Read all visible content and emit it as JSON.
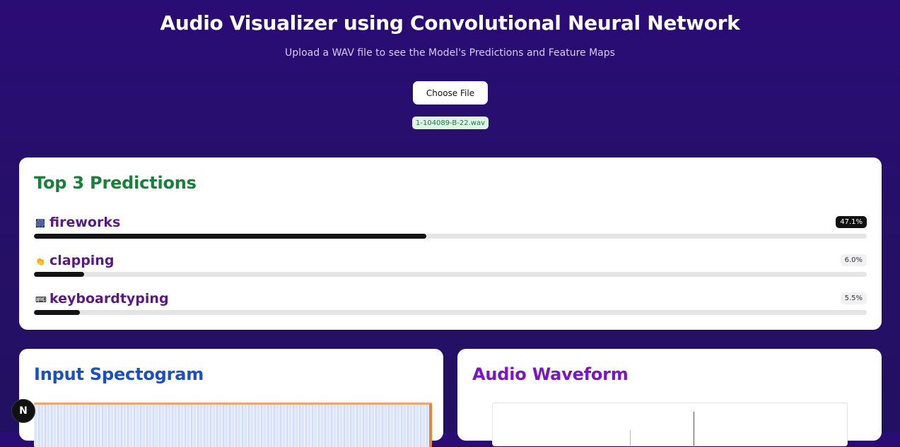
{
  "header": {
    "title": "Audio Visualizer using Convolutional Neural Network",
    "subtitle": "Upload a WAV file to see the Model's Predictions and Feature Maps",
    "choose_file_label": "Choose File",
    "file_name": "1-104089-B-22.wav"
  },
  "predictions": {
    "title": "Top 3 Predictions",
    "items": [
      {
        "icon": "fireworks-icon",
        "glyph": "🎆",
        "label": "fireworks",
        "percent": "47.1%",
        "fraction": 0.471
      },
      {
        "icon": "clapping-icon",
        "glyph": "👏",
        "label": "clapping",
        "percent": "6.0%",
        "fraction": 0.06
      },
      {
        "icon": "keyboard-icon",
        "glyph": "⌨",
        "label": "keyboardtyping",
        "percent": "5.5%",
        "fraction": 0.055
      }
    ]
  },
  "spectrogram": {
    "title": "Input Spectogram"
  },
  "waveform": {
    "title": "Audio Waveform"
  },
  "dev_badge": {
    "letter": "N"
  },
  "colors": {
    "background": "#2a0c75",
    "predictions_title": "#1a7f3a",
    "prediction_label": "#5a1a86",
    "spectrogram_title": "#1a4fc7",
    "waveform_title": "#7a16c7",
    "bar_fill": "#141414"
  }
}
